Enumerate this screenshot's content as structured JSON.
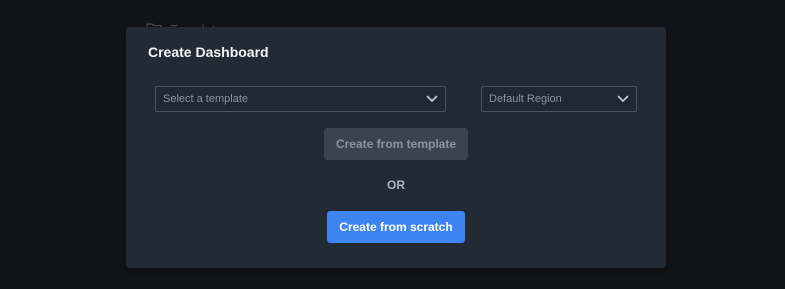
{
  "backdrop": {
    "folder_label": "Templates",
    "folder_icon": "folder-icon"
  },
  "modal": {
    "title": "Create Dashboard",
    "template_select": {
      "placeholder": "Select a template",
      "icon": "chevron-down-icon"
    },
    "region_select": {
      "value": "Default Region",
      "icon": "chevron-down-icon"
    },
    "create_from_template_label": "Create from template",
    "or_label": "OR",
    "create_from_scratch_label": "Create from scratch"
  },
  "colors": {
    "page_background": "#111419",
    "modal_background": "#222a34",
    "primary_button": "#3e84f1",
    "disabled_button": "#3b434d"
  }
}
